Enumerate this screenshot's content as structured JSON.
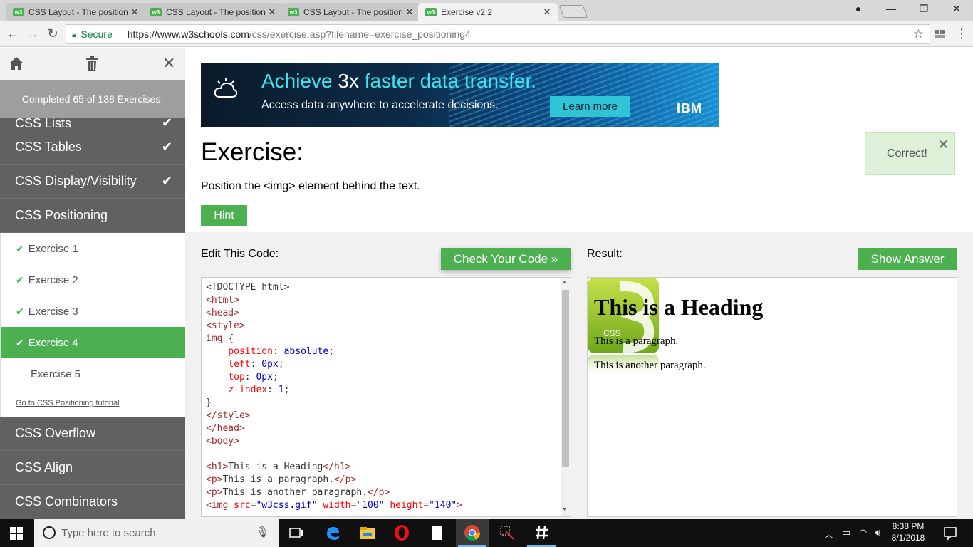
{
  "browser": {
    "tabs": [
      {
        "title": "CSS Layout - The position",
        "favicon": "w3"
      },
      {
        "title": "CSS Layout - The position",
        "favicon": "w3"
      },
      {
        "title": "CSS Layout - The position",
        "favicon": "w3"
      },
      {
        "title": "Exercise v2.2",
        "favicon": "w3"
      }
    ],
    "security_label": "Secure",
    "url_host": "https://www.w3schools.com",
    "url_path": "/css/exercise.asp?filename=exercise_positioning4"
  },
  "sidebar": {
    "completed_text": "Completed 65 of 138 Exercises:",
    "sections_before": [
      {
        "label": "CSS Lists",
        "done": true
      },
      {
        "label": "CSS Tables",
        "done": true
      },
      {
        "label": "CSS Display/Visibility",
        "done": true
      }
    ],
    "current_section": "CSS Positioning",
    "exercises": [
      {
        "label": "Exercise 1",
        "done": true
      },
      {
        "label": "Exercise 2",
        "done": true
      },
      {
        "label": "Exercise 3",
        "done": true
      },
      {
        "label": "Exercise 4",
        "done": true,
        "active": true
      },
      {
        "label": "Exercise 5",
        "done": false
      }
    ],
    "tutorial_link": "Go to CSS Positioning tutorial",
    "sections_after": [
      {
        "label": "CSS Overflow"
      },
      {
        "label": "CSS Align"
      },
      {
        "label": "CSS Combinators"
      }
    ]
  },
  "ad": {
    "headline_1": "Achieve ",
    "headline_2": "3x",
    "headline_3": " faster data transfer.",
    "subline": "Access data anywhere to accelerate decisions.",
    "cta": "Learn more",
    "brand": "IBM"
  },
  "exercise": {
    "title": "Exercise:",
    "task": "Position the <img> element behind the text.",
    "hint_label": "Hint",
    "correct_text": "Correct!"
  },
  "editor": {
    "label": "Edit This Code:",
    "check_label": "Check Your Code »"
  },
  "result": {
    "label": "Result:",
    "show_answer_label": "Show Answer",
    "heading": "This is a Heading",
    "paragraph_1": "This is a paragraph.",
    "paragraph_2": "This is another paragraph.",
    "img_text": "CSS"
  },
  "taskbar": {
    "search_placeholder": "Type here to search",
    "time": "8:38 PM",
    "date": "8/1/2018"
  },
  "colors": {
    "accent_green": "#4caf50",
    "sidebar_bg": "#616161",
    "correct_bg": "#dff0d8"
  }
}
